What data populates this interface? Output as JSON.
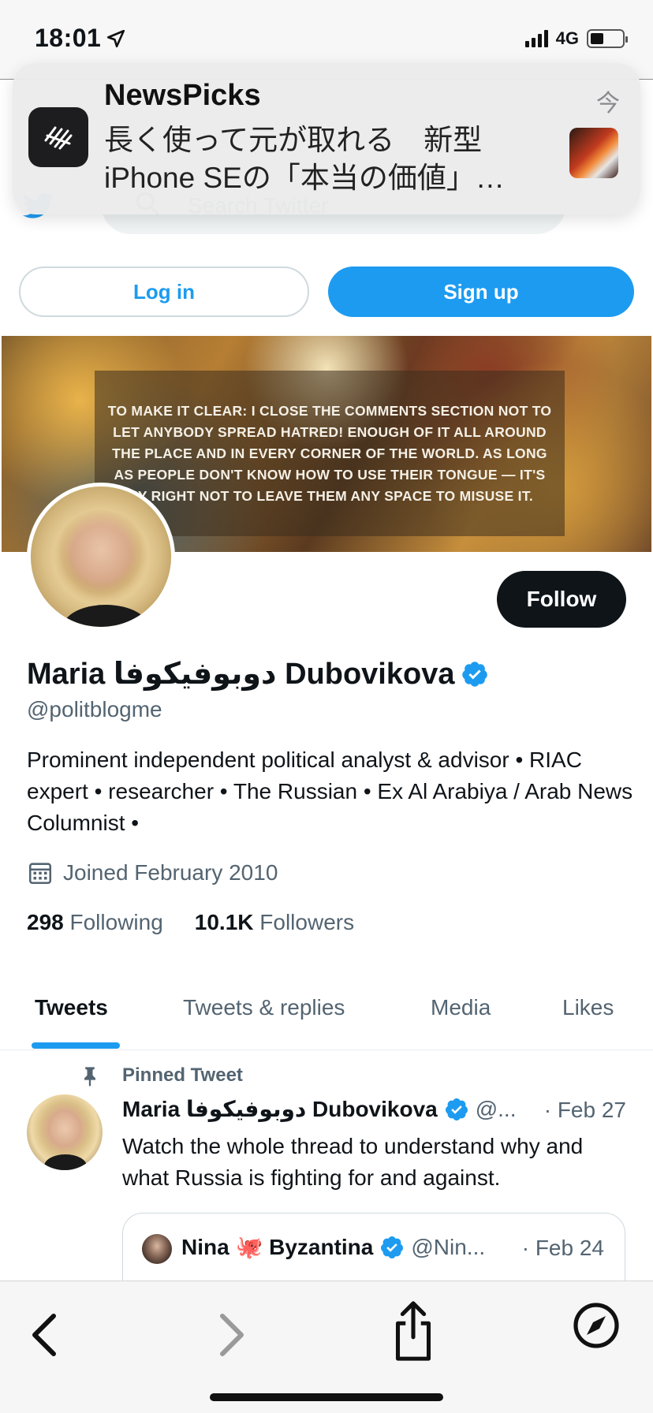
{
  "status_bar": {
    "time": "18:01",
    "network": "4G"
  },
  "header": {
    "search_placeholder": "Search Twitter"
  },
  "notification": {
    "app_name": "NewsPicks",
    "time": "今",
    "body": "長く使って元が取れる　新型iPhone SEの「本当の価値」…"
  },
  "auth": {
    "login_label": "Log in",
    "signup_label": "Sign up"
  },
  "cover": {
    "text": "TO MAKE IT CLEAR: I CLOSE THE COMMENTS SECTION NOT TO LET ANYBODY SPREAD HATRED! ENOUGH OF IT ALL AROUND THE PLACE AND IN EVERY CORNER OF THE WORLD. AS LONG AS PEOPLE DON'T KNOW HOW TO USE THEIR TONGUE — IT'S MY RIGHT NOT TO LEAVE THEM ANY SPACE TO MISUSE IT."
  },
  "profile": {
    "follow_label": "Follow",
    "name": "Maria دوبوفيكوفا Dubovikova",
    "handle": "@politblogme",
    "bio": "Prominent independent political analyst & advisor • RIAC expert • researcher • The Russian • Ex Al Arabiya / Arab News Columnist •",
    "joined": "Joined February 2010",
    "following_count": "298",
    "following_label": "Following",
    "followers_count": "10.1K",
    "followers_label": "Followers"
  },
  "tabs": [
    {
      "label": "Tweets",
      "active": true
    },
    {
      "label": "Tweets & replies",
      "active": false
    },
    {
      "label": "Media",
      "active": false
    },
    {
      "label": "Likes",
      "active": false
    }
  ],
  "pinned_tweet": {
    "pinned_label": "Pinned Tweet",
    "author_name": "Maria دوبوفيكوفا Dubovikova",
    "author_handle": "@...",
    "date": "· Feb 27",
    "text": "Watch the whole thread to understand why and what Russia is fighting for and against.",
    "quote": {
      "author_name": "Nina 🐙 Byzantina",
      "author_handle": "@Nin...",
      "date": "· Feb 24"
    }
  },
  "colors": {
    "accent": "#1d9bf0",
    "text_primary": "#0f1419",
    "text_secondary": "#536471"
  }
}
